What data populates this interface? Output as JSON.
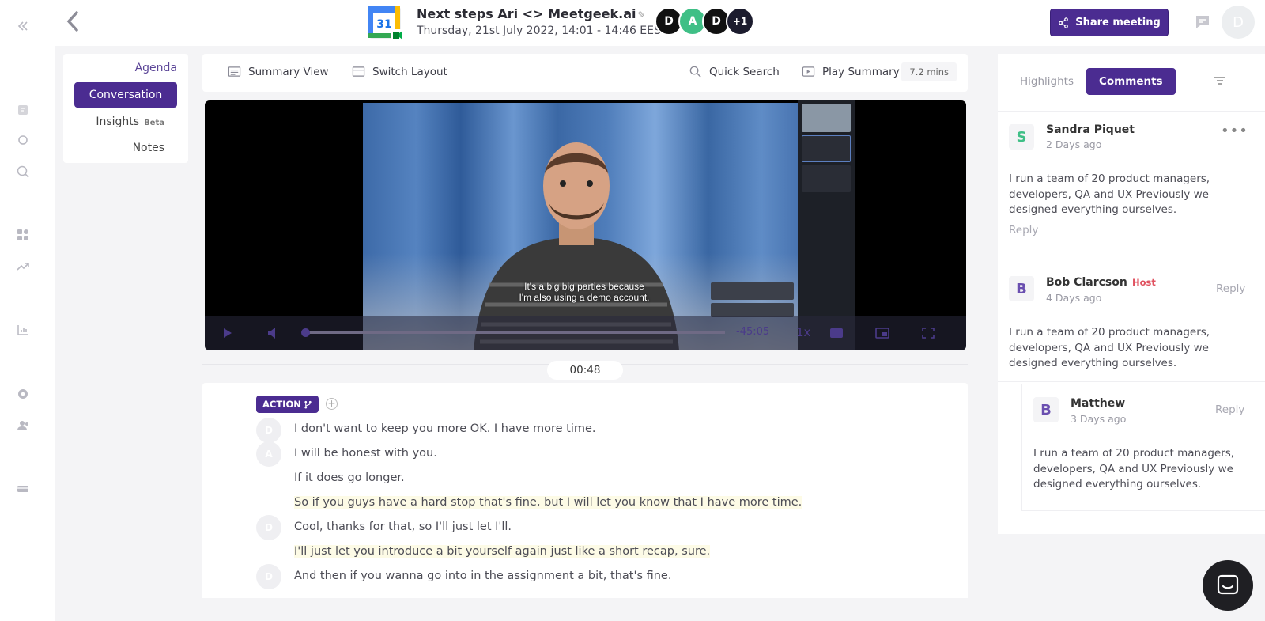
{
  "header": {
    "meeting_title": "Next steps Ari <> Meetgeek.ai",
    "meeting_date": "Thursday, 21st July 2022, 14:01 - 14:46 EEST",
    "calendar_day": "31",
    "participants": [
      {
        "initial": "D",
        "color": "#111111"
      },
      {
        "initial": "A",
        "color": "#3fbf86"
      },
      {
        "initial": "D",
        "color": "#111111"
      },
      {
        "initial": "+1",
        "color": "#1c1c2e"
      }
    ],
    "share_label": "Share meeting",
    "user_initial": "D"
  },
  "tabs": {
    "agenda": "Agenda",
    "conversation": "Conversation",
    "insights": "Insights",
    "insights_badge": "Beta",
    "notes": "Notes"
  },
  "toolbar": {
    "summary_view": "Summary View",
    "switch_layout": "Switch Layout",
    "quick_search": "Quick Search",
    "play_summary": "Play Summary",
    "summary_length": "7.2 mins"
  },
  "video": {
    "subtitle_line1": "It's a big big parties because",
    "subtitle_line2": "I'm also using a demo account,",
    "time_remaining": "-45:05",
    "speed": "1x",
    "progress": 0.0,
    "current_time": "00:48"
  },
  "transcript": {
    "tag_label": "ACTION",
    "lines": [
      {
        "speaker": "D",
        "text": "I don't want to keep you more OK. I have more time."
      },
      {
        "speaker": "A",
        "text": "I will be honest with you."
      },
      {
        "speaker": "",
        "text": "If it does go longer."
      },
      {
        "speaker": "",
        "text": "So if you guys have a hard stop that's fine, but I will let you know that I have more time.",
        "highlighted": true
      },
      {
        "speaker": "D",
        "text": "Cool, thanks for that, so I'll just let I'll."
      },
      {
        "speaker": "",
        "text": "I'll just let you introduce a bit yourself again just like a short recap, sure.",
        "highlighted": true
      },
      {
        "speaker": "D",
        "text": "And then if you wanna go into in the assignment a bit, that's fine."
      }
    ]
  },
  "comments_panel": {
    "highlights_tab": "Highlights",
    "comments_tab": "Comments",
    "comments": [
      {
        "initial": "S",
        "name": "Sandra Piquet",
        "time": "2 Days ago",
        "text": "I run a team of 20 product managers, developers, QA and UX Previously we designed everything ourselves.",
        "reply": "Reply",
        "color": "#3fbf86"
      },
      {
        "initial": "B",
        "name": "Bob Clarcson",
        "badge": "Host",
        "time": "4 Days ago",
        "text": "I run a team of 20 product managers, developers, QA and UX Previously we designed everything ourselves.",
        "reply": "Reply",
        "color": "#6a4fb0"
      },
      {
        "initial": "B",
        "name": "Matthew",
        "time": "3 Days ago",
        "text": "I run a team of 20 product managers, developers, QA and UX Previously we designed everything ourselves.",
        "reply": "Reply",
        "color": "#6a4fb0"
      }
    ]
  }
}
